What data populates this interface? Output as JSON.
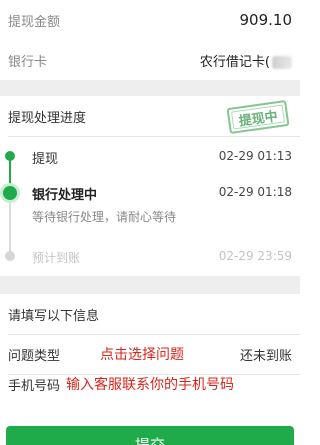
{
  "summary": {
    "amount_label": "提现金额",
    "amount_value": "909.10",
    "card_label": "银行卡",
    "card_value": "农行借记卡("
  },
  "progress": {
    "title": "提现处理进度",
    "stamp": "提现中",
    "steps": [
      {
        "title": "提现",
        "time": "02-29 01:13"
      },
      {
        "title": "银行处理中",
        "time": "02-29 01:18",
        "desc": "等待银行处理，请耐心等待"
      },
      {
        "title": "预计到账",
        "time": "02-29 23:59"
      }
    ],
    "colors": {
      "active": "#1fab4a",
      "inactive": "#cccccc"
    }
  },
  "form": {
    "title": "请填写以下信息",
    "issue_label": "问题类型",
    "issue_hint": "点击选择问题",
    "issue_value": "还未到账",
    "phone_label": "手机号码",
    "phone_hint": "输入客服联系你的手机号码"
  },
  "submit_label": "提交"
}
